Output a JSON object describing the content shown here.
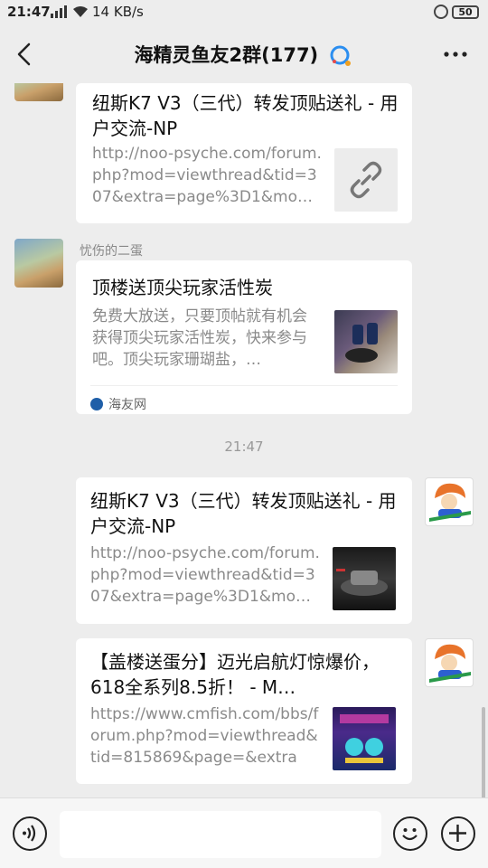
{
  "status_bar": {
    "time": "21:47",
    "speed": "14 KB/s",
    "battery": "50"
  },
  "header": {
    "title": "海精灵鱼友2群(177)"
  },
  "messages": [
    {
      "sender": "",
      "title": "纽斯K7 V3（三代）转发顶贴送礼 - 用户交流-NP",
      "description": "http://noo-psyche.com/forum.php?mod=viewthread&tid=307&extra=page%3D1&mo…",
      "thumb_icon": "link-icon"
    },
    {
      "sender": "忧伤的二蛋",
      "title": "顶楼送顶尖玩家活性炭",
      "description": "免费大放送，只要顶帖就有机会获得顶尖玩家活性炭，快来参与吧。顶尖玩家珊瑚盐，…",
      "source": "海友网"
    },
    {
      "timestamp": "21:47"
    },
    {
      "title": "纽斯K7 V3（三代）转发顶贴送礼 - 用户交流-NP",
      "description": "http://noo-psyche.com/forum.php?mod=viewthread&tid=307&extra=page%3D1&mo…"
    },
    {
      "title": "【盖楼送蛋分】迈光启航灯惊爆价，618全系列8.5折！ - M…",
      "description": "https://www.cmfish.com/bbs/forum.php?mod=viewthread&tid=815869&page=&extra=…"
    }
  ],
  "colors": {
    "background": "#ededed",
    "card": "#ffffff",
    "muted_text": "#8a8a8a"
  }
}
